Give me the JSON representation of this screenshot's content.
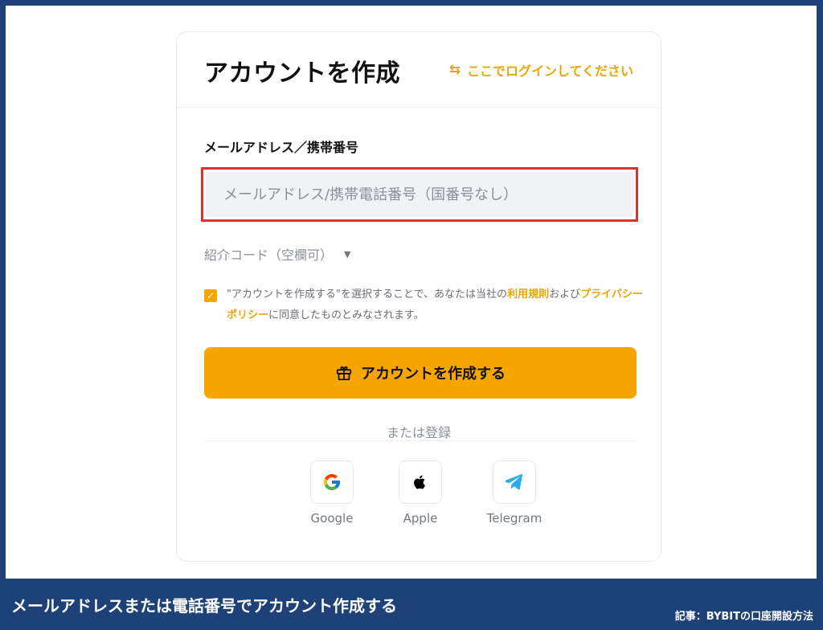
{
  "card": {
    "title": "アカウントを作成",
    "login_link": "ここでログインしてください"
  },
  "form": {
    "field_label": "メールアドレス／携帯番号",
    "input_placeholder": "メールアドレス/携帯電話番号（国番号なし）",
    "input_value": "",
    "referral_label": "紹介コード（空欄可）",
    "terms": {
      "checked": true,
      "prefix": "\"アカウントを作成する\"を選択することで、あなたは当社の",
      "terms_link": "利用規則",
      "middle": "および",
      "privacy_link": "プライバシーポリシー",
      "suffix": "に同意したものとみなされます。"
    },
    "submit_label": "アカウントを作成する"
  },
  "signup_alt": {
    "label": "または登録",
    "providers": [
      {
        "name": "Google",
        "icon": "google-icon"
      },
      {
        "name": "Apple",
        "icon": "apple-icon"
      },
      {
        "name": "Telegram",
        "icon": "telegram-icon"
      }
    ]
  },
  "footer": {
    "caption": "メールアドレスまたは電話番号でアカウント作成する",
    "source": "記事：BYBITの口座開設方法"
  },
  "colors": {
    "accent": "#f7a600",
    "link": "#e8a50a",
    "highlight_border": "#e03131",
    "banner": "#1e4177"
  }
}
